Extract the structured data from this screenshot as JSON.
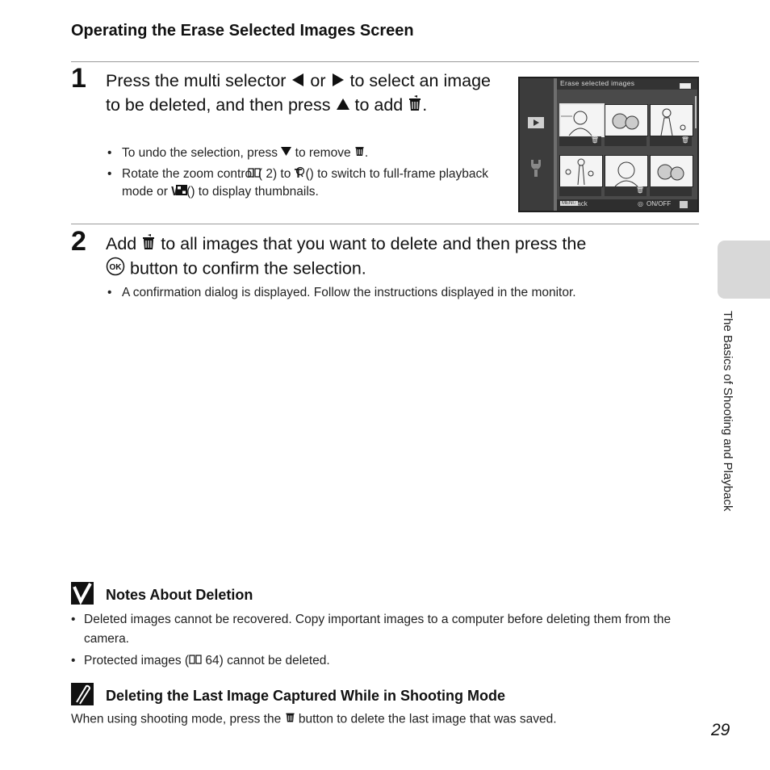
{
  "page": {
    "section_title": "Operating the Erase Selected Images Screen",
    "side_tab_label": "The Basics of Shooting and Playback",
    "page_number": "29"
  },
  "step1": {
    "number": "1",
    "text_a": "Press the multi selector",
    "text_or": "or",
    "text_b": "to select an image to be deleted, and then press",
    "text_c": "to add",
    "text_end": ".",
    "bullets": [
      {
        "a": "To undo the selection, press",
        "b": "to remove",
        "c": "."
      },
      {
        "a": "Rotate the zoom control (",
        "ref": "2",
        "b": ") to",
        "T": "T",
        "c": "(",
        "d": ") to switch to full-frame playback mode or",
        "W": "W",
        "e": "(",
        "f": ") to display thumbnails."
      }
    ]
  },
  "step2": {
    "number": "2",
    "text_a": "Add",
    "text_b": "to all images that you want to delete and then press the",
    "text_c": "button to confirm the selection.",
    "ok_label": "OK",
    "bullet": "A confirmation dialog is displayed. Follow the instructions displayed in the monitor."
  },
  "camera_screen": {
    "title": "Erase selected images",
    "footer_menu": "MENU",
    "footer_back": "Back",
    "footer_toggle": "ON/OFF",
    "thumbnails": [
      {
        "subject": "woman portrait",
        "marked": true
      },
      {
        "subject": "flowers",
        "marked": false
      },
      {
        "subject": "woman with child",
        "marked": true
      },
      {
        "subject": "family",
        "marked": false
      },
      {
        "subject": "woman portrait",
        "marked": true
      },
      {
        "subject": "flowers",
        "marked": false
      }
    ]
  },
  "notes": {
    "title": "Notes About Deletion",
    "bullets": [
      {
        "text": "Deleted images cannot be recovered. Copy important images to a computer before deleting them from the camera."
      },
      {
        "a": "Protected images (",
        "ref": "64",
        "b": ") cannot be deleted."
      }
    ]
  },
  "tip": {
    "title": "Deleting the Last Image Captured While in Shooting Mode",
    "text_a": "When using shooting mode, press the",
    "text_b": "button to delete the last image that was saved."
  }
}
